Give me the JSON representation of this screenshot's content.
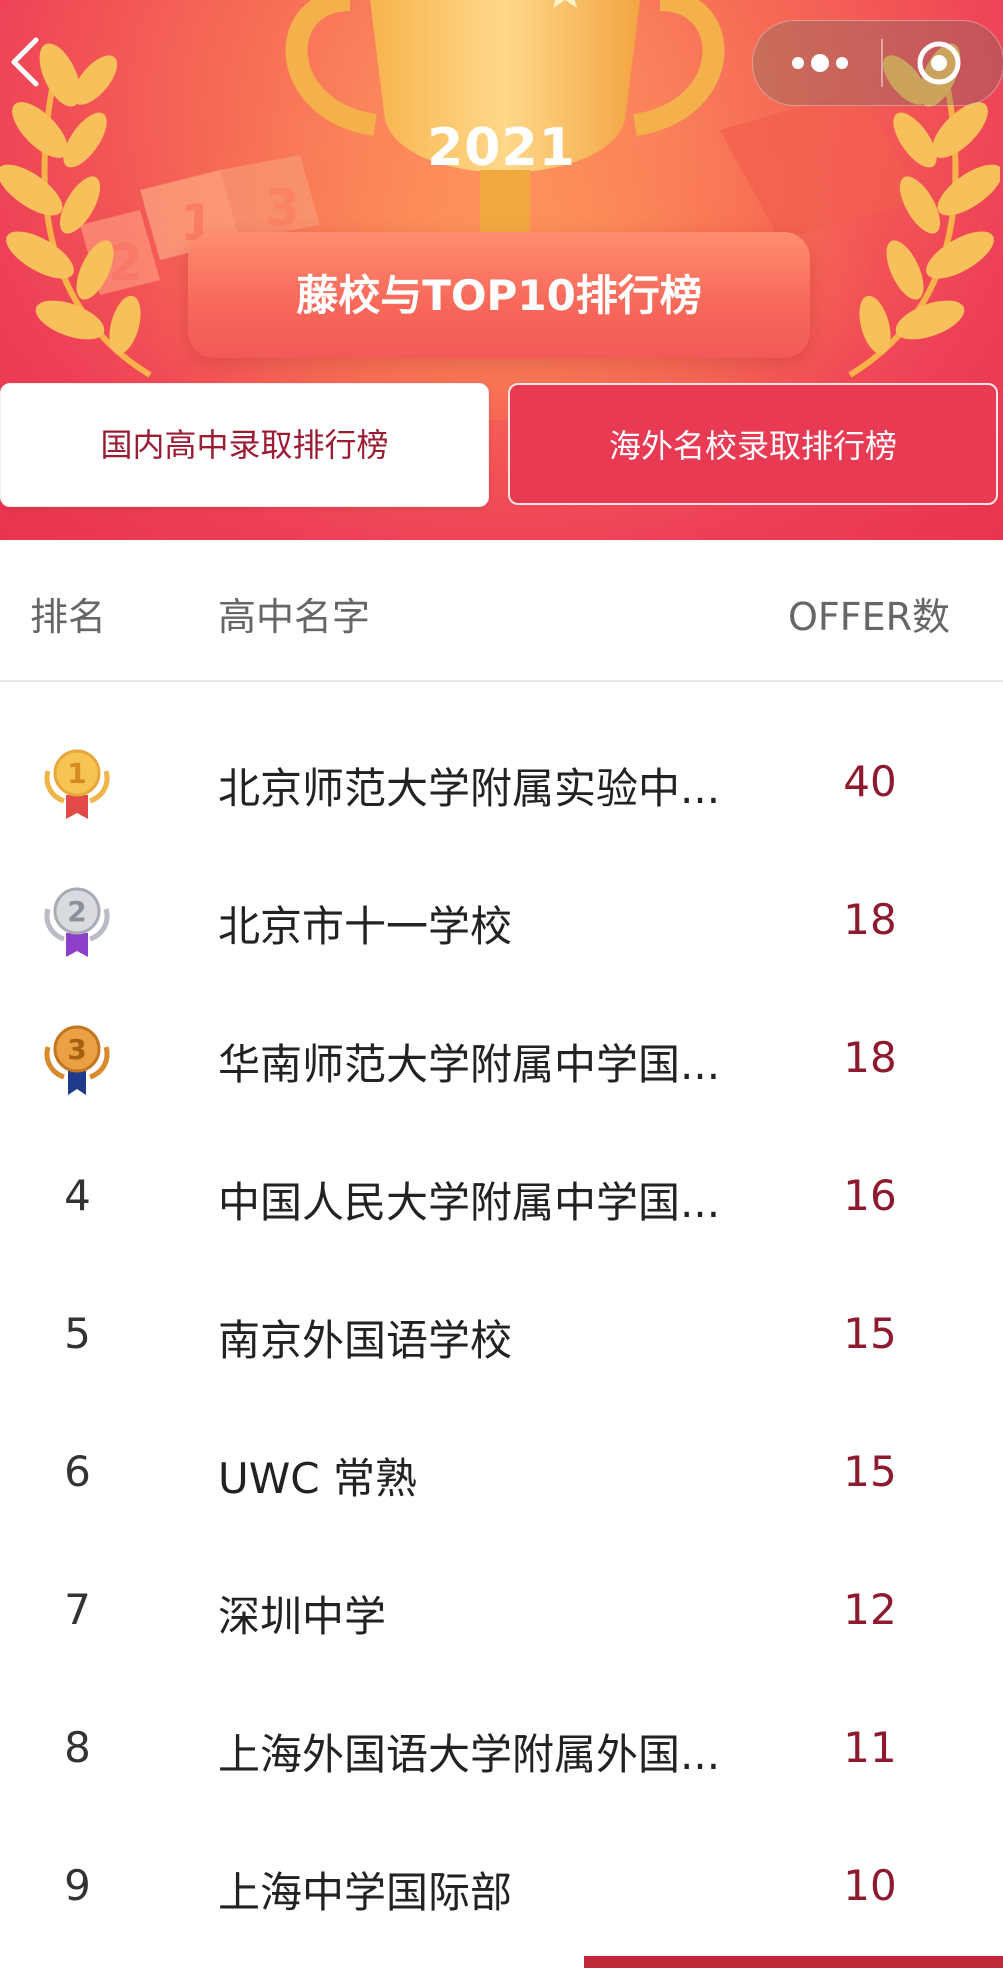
{
  "header": {
    "year": "2021",
    "title": "藤校与TOP10排行榜"
  },
  "tabs": [
    {
      "label": "国内高中录取排行榜",
      "active": true
    },
    {
      "label": "海外名校录取排行榜",
      "active": false
    }
  ],
  "table": {
    "columns": {
      "rank": "排名",
      "name": "高中名字",
      "offers": "OFFER数"
    },
    "rows": [
      {
        "rank": "1",
        "badge": "gold-medal-icon",
        "name": "北京师范大学附属实验中...",
        "offers": "40"
      },
      {
        "rank": "2",
        "badge": "silver-medal-icon",
        "name": "北京市十一学校",
        "offers": "18"
      },
      {
        "rank": "3",
        "badge": "bronze-medal-icon",
        "name": "华南师范大学附属中学国...",
        "offers": "18"
      },
      {
        "rank": "4",
        "name": "中国人民大学附属中学国...",
        "offers": "16"
      },
      {
        "rank": "5",
        "name": "南京外国语学校",
        "offers": "15"
      },
      {
        "rank": "6",
        "name": "UWC 常熟",
        "offers": "15"
      },
      {
        "rank": "7",
        "name": "深圳中学",
        "offers": "12"
      },
      {
        "rank": "8",
        "name": "上海外国语大学附属外国...",
        "offers": "11"
      },
      {
        "rank": "9",
        "name": "上海中学国际部",
        "offers": "10"
      }
    ]
  },
  "colors": {
    "banner": "#ee3f57",
    "accent": "#e83b53",
    "offer_text": "#8e1a2f",
    "gold": "#f4b83a",
    "silver": "#bfc1c8",
    "bronze": "#d98a2e"
  }
}
